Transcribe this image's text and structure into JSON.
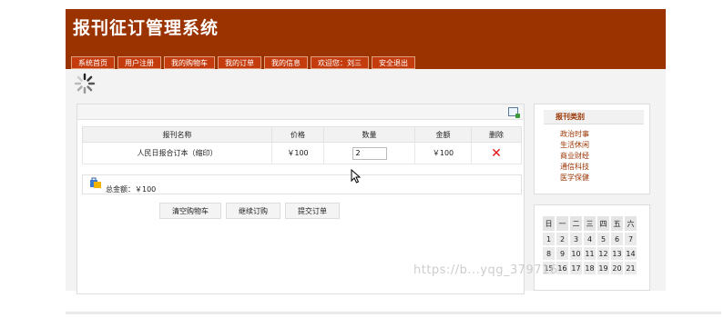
{
  "header": {
    "title": "报刊征订管理系统"
  },
  "nav": {
    "items": [
      {
        "label": "系统首页"
      },
      {
        "label": "用户注册"
      },
      {
        "label": "我的购物车"
      },
      {
        "label": "我的订单"
      },
      {
        "label": "我的信息"
      },
      {
        "label": "欢迎您：刘三"
      },
      {
        "label": "安全退出"
      }
    ]
  },
  "cart": {
    "headers": {
      "name": "报刊名称",
      "price": "价格",
      "qty": "数量",
      "amount": "金额",
      "delete": "删除"
    },
    "rows": [
      {
        "name": "人民日报合订本（缩印）",
        "price": "￥100",
        "qty": "2",
        "amount": "￥100"
      }
    ],
    "total_label": "总金额：￥100",
    "actions": {
      "clear": "清空购物车",
      "continue": "继续订购",
      "submit": "提交订单"
    }
  },
  "sidebar": {
    "category_title": "报刊类别",
    "categories": [
      {
        "label": "政治时事"
      },
      {
        "label": "生活休闲"
      },
      {
        "label": "商业财经"
      },
      {
        "label": "通信科技"
      },
      {
        "label": "医学保健"
      }
    ]
  },
  "calendar": {
    "weekdays": [
      "日",
      "一",
      "二",
      "三",
      "四",
      "五",
      "六"
    ],
    "weeks": [
      [
        "1",
        "2",
        "3",
        "4",
        "5",
        "6",
        "7"
      ],
      [
        "8",
        "9",
        "10",
        "11",
        "12",
        "13",
        "14"
      ],
      [
        "15",
        "16",
        "17",
        "18",
        "19",
        "20",
        "21"
      ]
    ]
  },
  "watermark": "https://b...yqg_379716"
}
